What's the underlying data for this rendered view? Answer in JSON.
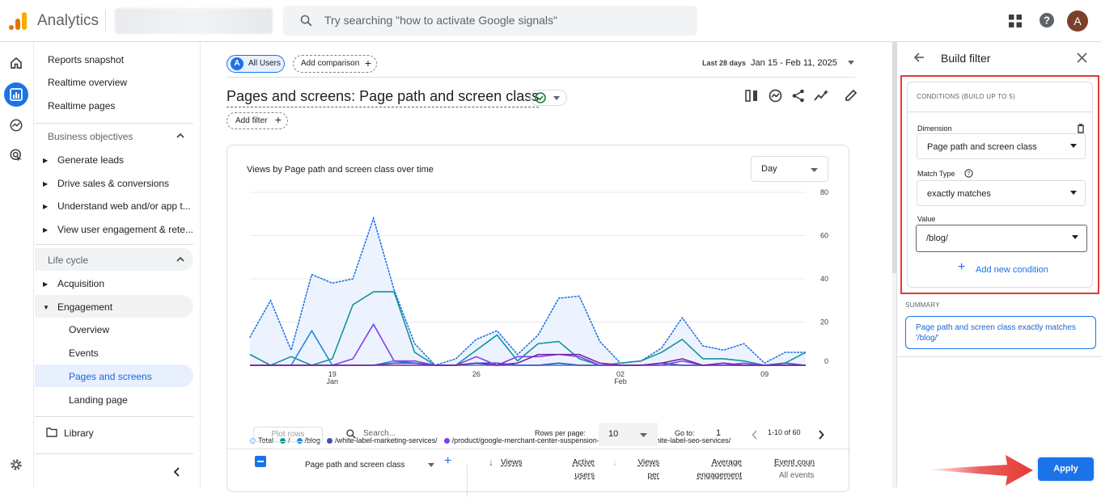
{
  "header": {
    "app_title": "Analytics",
    "search_placeholder": "Try searching \"how to activate Google signals\"",
    "avatar_letter": "A"
  },
  "nav": {
    "top_items": [
      "Reports snapshot",
      "Realtime overview",
      "Realtime pages"
    ],
    "business_title": "Business objectives",
    "business_items": [
      "Generate leads",
      "Drive sales & conversions",
      "Understand web and/or app t...",
      "View user engagement & rete..."
    ],
    "lifecycle_title": "Life cycle",
    "acquisition": "Acquisition",
    "engagement": "Engagement",
    "engagement_items": [
      "Overview",
      "Events",
      "Pages and screens",
      "Landing page"
    ],
    "library": "Library"
  },
  "main": {
    "segment_chip": "All Users",
    "segment_letter": "A",
    "add_comparison": "Add comparison",
    "date_label": "Last 28 days",
    "date_range": "Jan 15 - Feb 11, 2025",
    "page_title": "Pages and screens: Page path and screen class",
    "add_filter": "Add filter"
  },
  "chart_data": {
    "type": "line",
    "title": "Views by Page path and screen class over time",
    "granularity": "Day",
    "x": [
      "Jan 15",
      "Jan 16",
      "Jan 17",
      "Jan 18",
      "Jan 19",
      "Jan 20",
      "Jan 21",
      "Jan 22",
      "Jan 23",
      "Jan 24",
      "Jan 25",
      "Jan 26",
      "Jan 27",
      "Jan 28",
      "Jan 29",
      "Jan 30",
      "Jan 31",
      "Feb 01",
      "Feb 02",
      "Feb 03",
      "Feb 04",
      "Feb 05",
      "Feb 06",
      "Feb 07",
      "Feb 08",
      "Feb 09",
      "Feb 10",
      "Feb 11"
    ],
    "x_ticks": [
      {
        "label": "19",
        "sub": "Jan",
        "index": 4
      },
      {
        "label": "26",
        "sub": "",
        "index": 11
      },
      {
        "label": "02",
        "sub": "Feb",
        "index": 18
      },
      {
        "label": "09",
        "sub": "",
        "index": 25
      }
    ],
    "y_ticks": [
      "80",
      "60",
      "40",
      "20",
      "0"
    ],
    "ylim": [
      0,
      80
    ],
    "series": [
      {
        "name": "Total",
        "color": "#1a73e8",
        "style": "dotted-area",
        "values": [
          13,
          30,
          7,
          42,
          38,
          40,
          68,
          35,
          10,
          0,
          3,
          12,
          16,
          5,
          14,
          31,
          32,
          11,
          1,
          2,
          8,
          22,
          9,
          7,
          10,
          1,
          6,
          6
        ]
      },
      {
        "name": "/",
        "color": "#12939a",
        "values": [
          5,
          0,
          4,
          0,
          3,
          28,
          34,
          34,
          6,
          0,
          0,
          7,
          14,
          2,
          10,
          11,
          3,
          0,
          1,
          2,
          6,
          12,
          3,
          3,
          2,
          0,
          1,
          6
        ]
      },
      {
        "name": "/blog",
        "color": "#1e88e5",
        "values": [
          0,
          0,
          0,
          16,
          0,
          0,
          0,
          2,
          1,
          0,
          0,
          0,
          0,
          0,
          0,
          0,
          0,
          0,
          0,
          0,
          0,
          0,
          0,
          0,
          0,
          0,
          0,
          0
        ]
      },
      {
        "name": "/white-label-marketing-services/",
        "color": "#3f51b5",
        "values": [
          0,
          0,
          0,
          0,
          0,
          0,
          0,
          1,
          1,
          0,
          0,
          1,
          1,
          0,
          0,
          1,
          0,
          0,
          0,
          0,
          1,
          0,
          0,
          0,
          0,
          0,
          1,
          0
        ]
      },
      {
        "name": "/product/google-merchant-center-suspension-fix-service/",
        "color": "#7e3ff2",
        "values": [
          0,
          0,
          0,
          0,
          0,
          3,
          19,
          2,
          2,
          0,
          0,
          4,
          0,
          4,
          4,
          5,
          4,
          0,
          0,
          0,
          0,
          2,
          0,
          0,
          1,
          0,
          0,
          0
        ]
      },
      {
        "name": "/white-label-seo-services/",
        "color": "#7b1fa2",
        "values": [
          0,
          0,
          0,
          0,
          0,
          0,
          0,
          0,
          0,
          0,
          0,
          1,
          0,
          1,
          5,
          5,
          5,
          1,
          0,
          0,
          1,
          3,
          0,
          1,
          0,
          0,
          0,
          0
        ]
      }
    ]
  },
  "table": {
    "plot_rows": "Plot rows",
    "search_placeholder": "Search...",
    "rows_per_page_label": "Rows per page:",
    "rows_per_page": "10",
    "goto_label": "Go to:",
    "goto_value": "1",
    "pager": "1-10 of 60",
    "col_dimension": "Page path and screen class",
    "col_views": "Views",
    "col_active_users": "Active users",
    "col_views_per_user": "Views per active",
    "col_avg_engagement": "Average engagement time per",
    "col_event_count": "Event coun",
    "col_event_count_sub": "All events"
  },
  "panel": {
    "title": "Build filter",
    "conditions_header": "CONDITIONS (BUILD UP TO 5)",
    "dimension_label": "Dimension",
    "dimension_value": "Page path and screen class",
    "match_type_label": "Match Type",
    "match_type_value": "exactly matches",
    "value_label": "Value",
    "value_value": "/blog/",
    "add_condition": "Add new condition",
    "summary_label": "SUMMARY",
    "summary_text": "Page path and screen class exactly matches '/blog/'",
    "apply": "Apply"
  }
}
